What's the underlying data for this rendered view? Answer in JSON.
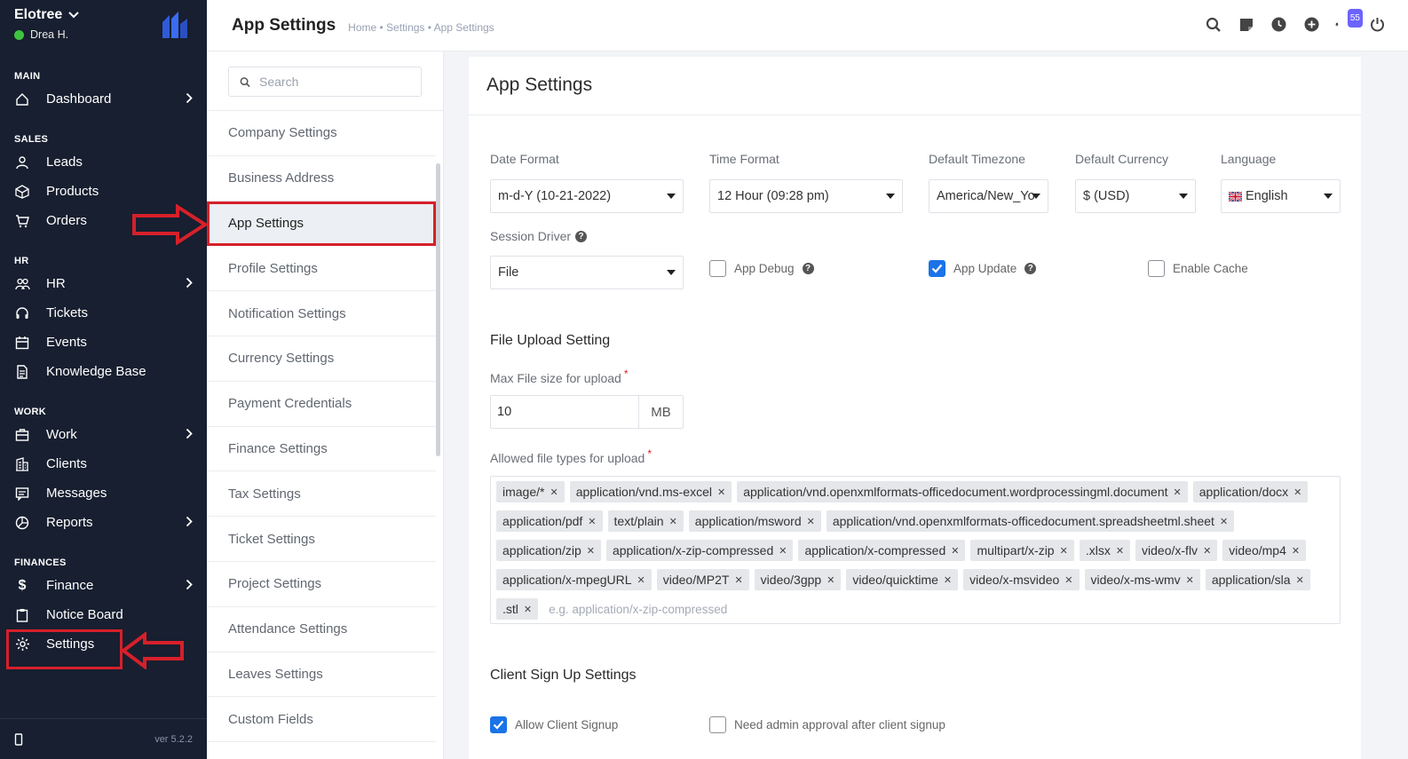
{
  "app": {
    "brand": "Elotree",
    "user": "Drea H.",
    "version": "ver 5.2.2"
  },
  "sidebar": {
    "sections": [
      {
        "title": "MAIN",
        "items": [
          {
            "label": "Dashboard",
            "icon": "home-icon",
            "chevron": true
          }
        ]
      },
      {
        "title": "SALES",
        "items": [
          {
            "label": "Leads",
            "icon": "user-icon"
          },
          {
            "label": "Products",
            "icon": "box-icon"
          },
          {
            "label": "Orders",
            "icon": "cart-icon"
          }
        ]
      },
      {
        "title": "HR",
        "items": [
          {
            "label": "HR",
            "icon": "people-icon",
            "chevron": true
          },
          {
            "label": "Tickets",
            "icon": "headset-icon"
          },
          {
            "label": "Events",
            "icon": "calendar-icon"
          },
          {
            "label": "Knowledge Base",
            "icon": "document-icon"
          }
        ]
      },
      {
        "title": "WORK",
        "items": [
          {
            "label": "Work",
            "icon": "briefcase-icon",
            "chevron": true
          },
          {
            "label": "Clients",
            "icon": "building-icon"
          },
          {
            "label": "Messages",
            "icon": "message-icon"
          },
          {
            "label": "Reports",
            "icon": "pie-chart-icon",
            "chevron": true
          }
        ]
      },
      {
        "title": "FINANCES",
        "items": [
          {
            "label": "Finance",
            "icon": "dollar-icon",
            "chevron": true
          },
          {
            "label": "Notice Board",
            "icon": "clipboard-icon"
          },
          {
            "label": "Settings",
            "icon": "gear-icon"
          }
        ]
      }
    ]
  },
  "header": {
    "title": "App Settings",
    "breadcrumb": "Home • Settings • App Settings",
    "notification_count": "55"
  },
  "settings_menu": {
    "search_placeholder": "Search",
    "items": [
      "Company Settings",
      "Business Address",
      "App Settings",
      "Profile Settings",
      "Notification Settings",
      "Currency Settings",
      "Payment Credentials",
      "Finance Settings",
      "Tax Settings",
      "Ticket Settings",
      "Project Settings",
      "Attendance Settings",
      "Leaves Settings",
      "Custom Fields"
    ],
    "active": "App Settings"
  },
  "form": {
    "title": "App Settings",
    "date_format": {
      "label": "Date Format",
      "value": "m-d-Y (10-21-2022)"
    },
    "time_format": {
      "label": "Time Format",
      "value": "12 Hour (09:28 pm)"
    },
    "timezone": {
      "label": "Default Timezone",
      "value": "America/New_Yo"
    },
    "currency": {
      "label": "Default Currency",
      "value": "$ (USD)"
    },
    "language": {
      "label": "Language",
      "value": "English"
    },
    "session_driver": {
      "label": "Session Driver",
      "value": "File"
    },
    "app_debug": {
      "label": "App Debug",
      "checked": false
    },
    "app_update": {
      "label": "App Update",
      "checked": true
    },
    "enable_cache": {
      "label": "Enable Cache",
      "checked": false
    },
    "file_upload": {
      "title": "File Upload Setting",
      "max_size_label": "Max File size for upload",
      "max_size_value": "10",
      "max_size_unit": "MB",
      "allowed_label": "Allowed file types for upload",
      "required_mark": "*",
      "tags": [
        "image/*",
        "application/vnd.ms-excel",
        "application/vnd.openxmlformats-officedocument.wordprocessingml.document",
        "application/docx",
        "application/pdf",
        "text/plain",
        "application/msword",
        "application/vnd.openxmlformats-officedocument.spreadsheetml.sheet",
        "application/zip",
        "application/x-zip-compressed",
        "application/x-compressed",
        "multipart/x-zip",
        ".xlsx",
        "video/x-flv",
        "video/mp4",
        "application/x-mpegURL",
        "video/MP2T",
        "video/3gpp",
        "video/quicktime",
        "video/x-msvideo",
        "video/x-ms-wmv",
        "application/sla",
        ".stl"
      ],
      "tags_placeholder": "e.g. application/x-zip-compressed"
    },
    "client_signup": {
      "title": "Client Sign Up Settings",
      "allow_label": "Allow Client Signup",
      "allow_checked": true,
      "approval_label": "Need admin approval after client signup",
      "approval_checked": false
    }
  },
  "colors": {
    "sidebar_bg": "#171f30",
    "annotation_red": "#d6202a",
    "checkbox_blue": "#1a73e8",
    "status_green": "#3ec33e"
  }
}
